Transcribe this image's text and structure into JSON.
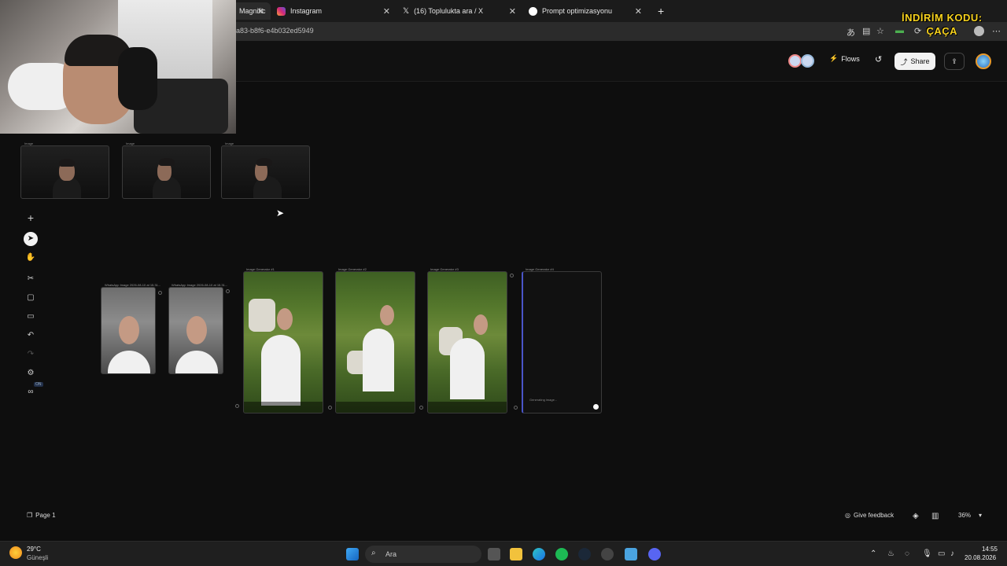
{
  "browser": {
    "tabs": [
      {
        "label": "Magnific",
        "icon": "magnific-icon"
      },
      {
        "label": "Instagram",
        "icon": "instagram-icon"
      },
      {
        "label": "(16) Toplulukta ara / X",
        "icon": "x-icon"
      },
      {
        "label": "Prompt optimizasyonu",
        "icon": "chatgpt-icon"
      }
    ],
    "new_tab": "+",
    "url": "a83-b8f6-e4b032ed5949"
  },
  "overlay": {
    "promo_line1": "İNDİRİM KODU:",
    "promo_line2": "ÇAÇA"
  },
  "header": {
    "flows_label": "Flows",
    "share_label": "Share"
  },
  "canvas": {
    "top_nodes": [
      {
        "label": "Image"
      },
      {
        "label": "Image"
      },
      {
        "label": "Image"
      }
    ],
    "input_nodes": [
      {
        "label": "WhatsApp Image 2026-08-10 at 15.31..."
      },
      {
        "label": "WhatsApp Image 2026-08-10 at 15.31..."
      }
    ],
    "generator_nodes": [
      {
        "label": "Image Generator #1"
      },
      {
        "label": "Image Generator #2"
      },
      {
        "label": "Image Generator #3"
      },
      {
        "label": "Image Generator #4"
      }
    ],
    "generating_text": "Generating image..."
  },
  "toolbar": {
    "on_badge": "ON"
  },
  "bottom": {
    "page_label": "Page 1",
    "feedback_label": "Give feedback",
    "zoom": "36%"
  },
  "taskbar": {
    "weather_temp": "29°C",
    "weather_desc": "Güneşli",
    "search_placeholder": "Ara",
    "time": "14:55",
    "date": "20.08.2026"
  },
  "colors": {
    "canvas_bg": "#0e0e0e",
    "promo_yellow": "#f7d21e",
    "share_bg": "#f2f2f2"
  }
}
